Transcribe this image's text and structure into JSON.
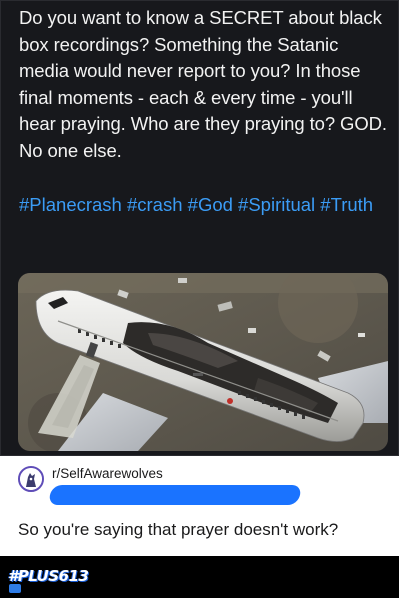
{
  "tweet": {
    "text": "Do you want to know a SECRET about black box recordings? Something the Satanic media would never report to you? In those final moments - each & every time - you'll hear praying. Who are they praying to? GOD. No one else.",
    "hashtags": "#Planecrash #crash #God #Spiritual #Truth",
    "hashtag_color": "#3b9cf5",
    "background_color": "#17181c"
  },
  "reply": {
    "subreddit": "r/SelfAwarewolves",
    "comment": "So you're saying that prayer doesn't work?",
    "redaction_color": "#1a73ff"
  },
  "footer": {
    "watermark": "#PLUS613"
  }
}
